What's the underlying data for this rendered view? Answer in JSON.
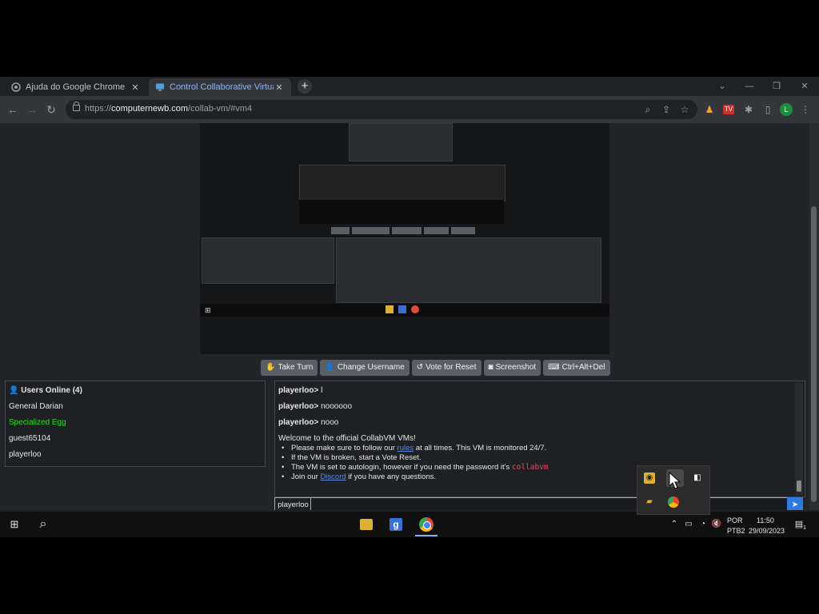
{
  "browser": {
    "tabs": [
      {
        "title": "Ajuda do Google Chrome",
        "active": false
      },
      {
        "title": "Control Collaborative Virtual Ma",
        "active": true
      }
    ],
    "new_tab": "+",
    "url_prefix": "https://",
    "url_domain": "computernewb.com",
    "url_path": "/collab-vm/#vm4",
    "profile_initial": "L"
  },
  "vm_controls": [
    {
      "icon": "hand-icon",
      "label": "Take Turn"
    },
    {
      "icon": "user-edit-icon",
      "label": "Change Username"
    },
    {
      "icon": "reset-icon",
      "label": "Vote for Reset"
    },
    {
      "icon": "camera-icon",
      "label": "Screenshot"
    },
    {
      "icon": "keyboard-icon",
      "label": "Ctrl+Alt+Del"
    }
  ],
  "users": {
    "header": "Users Online (4)",
    "list": [
      {
        "name": "General Darian",
        "color": "#e6e6e6"
      },
      {
        "name": "Specialized Egg",
        "color": "#22e51f"
      },
      {
        "name": "guest65104",
        "color": "#e6e6e6"
      },
      {
        "name": "playerloo",
        "color": "#e6e6e6"
      }
    ]
  },
  "chat": {
    "messages": [
      {
        "user": "playerloo",
        "text": "l"
      },
      {
        "user": "playerloo",
        "text": "noooooo"
      },
      {
        "user": "playerloo",
        "text": "nooo"
      }
    ],
    "welcome": "Welcome to the official CollabVM VMs!",
    "rules": {
      "r1_before": "Please make sure to follow our ",
      "r1_link": "rules",
      "r1_after": " at all times. This VM is monitored 24/7.",
      "r2": "If the VM is broken, start a Vote Reset.",
      "r3_before": "The VM is set to autologin, however if you need the password it's ",
      "r3_pw": "collabvm",
      "r4_before": "Join our ",
      "r4_link": "Discord",
      "r4_after": " if you have any questions."
    },
    "username": "playerloo"
  },
  "taskbar": {
    "lang1": "POR",
    "lang2": "PTB2",
    "time": "11:50",
    "date": "29/09/2023",
    "notification_count": "1"
  },
  "colors": {
    "accent": "#2d7be0",
    "button": "#5a5f66",
    "green_user": "#22e51f"
  }
}
